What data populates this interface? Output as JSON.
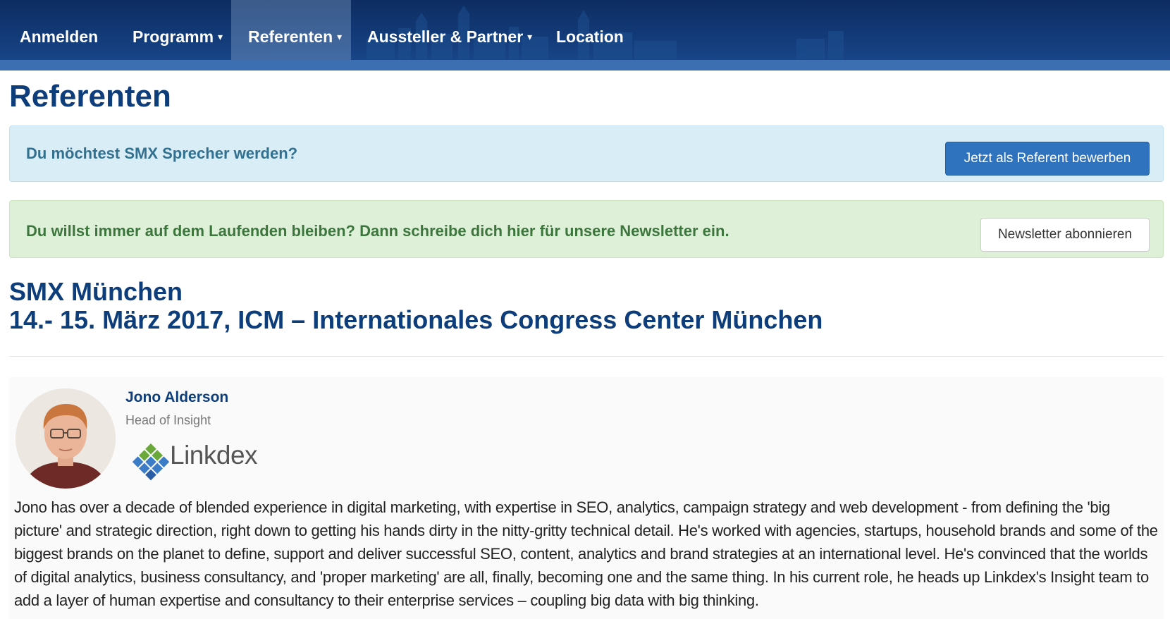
{
  "nav": {
    "items": [
      {
        "label": "Anmelden",
        "dropdown": false
      },
      {
        "label": "Programm",
        "dropdown": true
      },
      {
        "label": "Referenten",
        "dropdown": true,
        "active": true
      },
      {
        "label": "Aussteller & Partner",
        "dropdown": true
      },
      {
        "label": "Location",
        "dropdown": false
      }
    ],
    "caret": "▾"
  },
  "page": {
    "title": "Referenten"
  },
  "alerts": {
    "speaker": {
      "text": "Du möchtest SMX Sprecher werden?",
      "button": "Jetzt als Referent bewerben"
    },
    "newsletter": {
      "text": "Du willst immer auf dem Laufenden bleiben? Dann schreibe dich hier für unsere Newsletter ein.",
      "button": "Newsletter abonnieren"
    }
  },
  "event": {
    "name": "SMX München",
    "date_location": "14.- 15. März 2017, ICM – Internationales Congress Center München"
  },
  "speaker": {
    "name": "Jono Alderson",
    "title": "Head of Insight",
    "company": "Linkdex",
    "avatar_icon": "person-photo",
    "bio": "Jono has over a decade of blended experience in digital marketing, with expertise in SEO, analytics, campaign strategy and web development - from defining the 'big picture' and strategic direction, right down to getting his hands dirty in the nitty-gritty technical detail. He's worked with agencies, startups, household brands and some of the biggest brands on the planet to define, support and deliver successful SEO, content, analytics and brand strategies at an international level. He's convinced that the worlds of digital analytics, business consultancy, and 'proper marketing' are all, finally, becoming one and the same thing. In his current role, he heads up Linkdex's Insight team to add a layer of human expertise and consultancy to their enterprise services – coupling big data with big thinking."
  },
  "colors": {
    "nav_bg": "#143d7c",
    "heading": "#0d3d7a",
    "primary_button": "#2f73bf",
    "info_bg": "#d9edf7",
    "success_bg": "#dff0d8"
  }
}
